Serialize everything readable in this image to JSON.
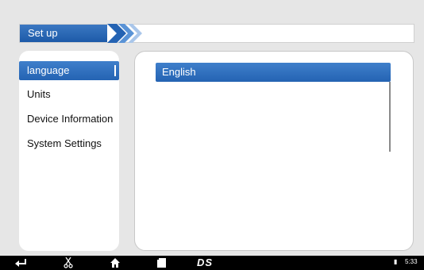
{
  "header": {
    "title": "Set up"
  },
  "sidebar": {
    "items": [
      {
        "label": "language"
      },
      {
        "label": "Units"
      },
      {
        "label": "Device Information"
      },
      {
        "label": "System Settings"
      }
    ],
    "selected": "language"
  },
  "content": {
    "languages": [
      {
        "label": "English"
      }
    ]
  },
  "navbar": {
    "icons": [
      "back-icon",
      "scissors-icon",
      "home-icon",
      "recent-apps-icon",
      "ds-logo"
    ],
    "logo_text": "DS",
    "time": "5:33"
  },
  "colors": {
    "accent": "#2463b3",
    "background": "#e6e6e6",
    "navbar": "#000000"
  }
}
